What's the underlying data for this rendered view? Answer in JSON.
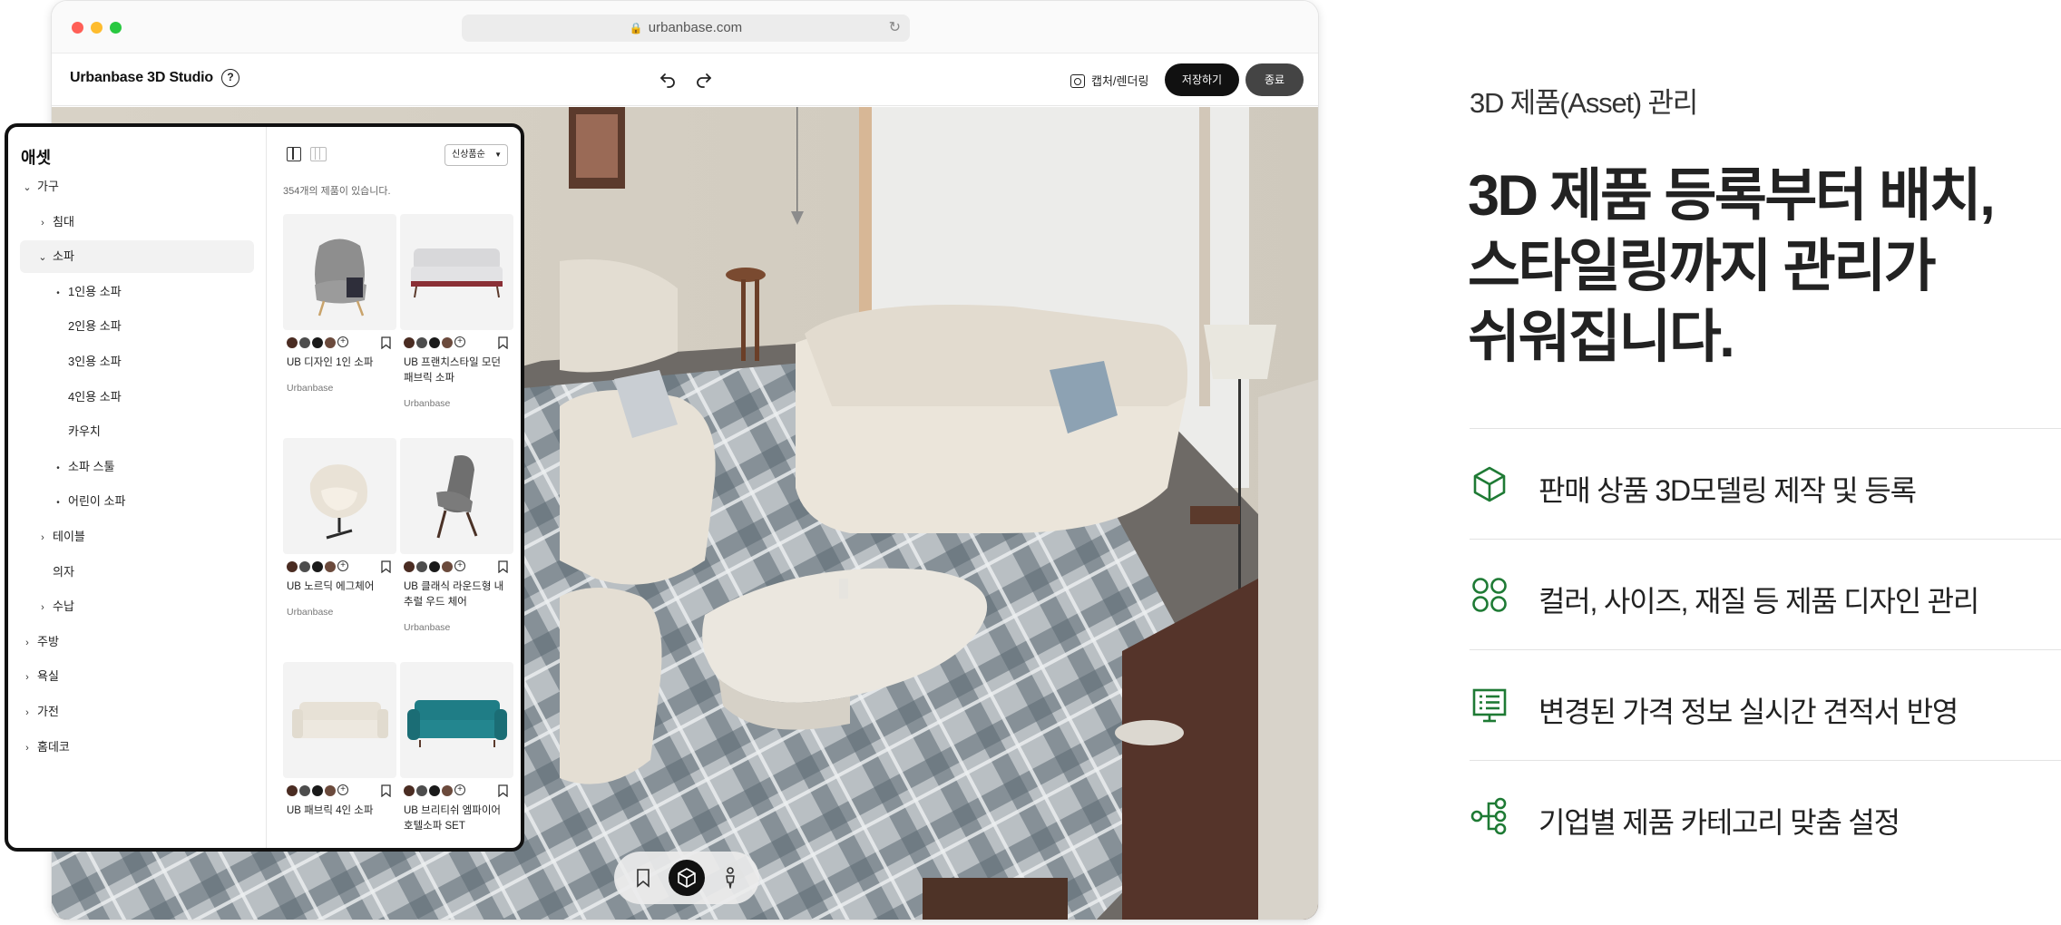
{
  "browser": {
    "url": "urbanbase.com"
  },
  "appbar": {
    "title": "Urbanbase 3D Studio",
    "help_glyph": "?",
    "capture_label": "캡처/렌더링",
    "save_label": "저장하기",
    "exit_label": "종료"
  },
  "panel": {
    "title": "애셋",
    "tree": [
      {
        "label": "가구",
        "marker": "⌄"
      },
      {
        "label": "침대",
        "marker": "›"
      },
      {
        "label": "소파",
        "marker": "⌄"
      },
      {
        "label": "1인용 소파",
        "marker": "•"
      },
      {
        "label": "2인용 소파",
        "marker": ""
      },
      {
        "label": "3인용 소파",
        "marker": ""
      },
      {
        "label": "4인용 소파",
        "marker": ""
      },
      {
        "label": "카우치",
        "marker": ""
      },
      {
        "label": "소파 스툴",
        "marker": "•"
      },
      {
        "label": "어린이 소파",
        "marker": "•"
      },
      {
        "label": "테이블",
        "marker": "›"
      },
      {
        "label": "의자",
        "marker": ""
      },
      {
        "label": "수납",
        "marker": "›"
      },
      {
        "label": "주방",
        "marker": "›"
      },
      {
        "label": "욕실",
        "marker": "›"
      },
      {
        "label": "가전",
        "marker": "›"
      },
      {
        "label": "홈데코",
        "marker": "›"
      }
    ],
    "sort": "신상품순",
    "count_text": "354개의 제품이 있습니다.",
    "products": [
      {
        "name": "UB 디자인 1인 소파",
        "brand": "Urbanbase"
      },
      {
        "name": "UB 프랜치스타일 모던 패브릭 소파",
        "brand": "Urbanbase"
      },
      {
        "name": "UB 노르딕 에그체어",
        "brand": "Urbanbase"
      },
      {
        "name": "UB 클래식 라운드형 내추럴 우드 체어",
        "brand": "Urbanbase"
      },
      {
        "name": "UB 패브릭 4인 소파",
        "brand": ""
      },
      {
        "name": "UB 브리티쉬 엠파이어 호텔소파 SET",
        "brand": ""
      }
    ],
    "swatch_colors": [
      "#4a2c22",
      "#4d4d4d",
      "#1a1a1a",
      "#6b4a3c"
    ],
    "swatch_add": "+"
  },
  "viewbar": {
    "items": [
      {
        "icon": "bookmark-icon"
      },
      {
        "icon": "cube-view-icon"
      },
      {
        "icon": "person-view-icon"
      }
    ]
  },
  "marketing": {
    "section_label": "3D 제품(Asset) 관리",
    "headline": [
      "3D 제품 등록부터 배치,",
      "스타일링까지 관리가",
      "쉬워집니다."
    ],
    "accent_color": "#1e7a34",
    "features": [
      {
        "icon": "cube-icon",
        "text": "판매 상품 3D모델링 제작 및 등록"
      },
      {
        "icon": "four-circles-icon",
        "text": "컬러, 사이즈, 재질 등 제품 디자인 관리"
      },
      {
        "icon": "estimate-list-icon",
        "text": "변경된 가격 정보 실시간 견적서 반영"
      },
      {
        "icon": "category-tree-icon",
        "text": "기업별 제품 카테고리 맞춤 설정"
      }
    ]
  }
}
